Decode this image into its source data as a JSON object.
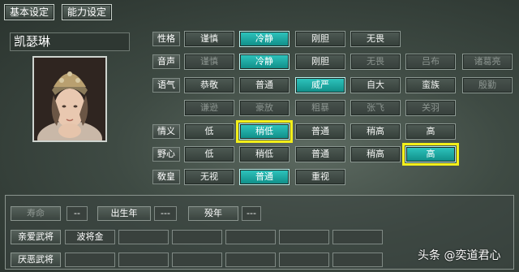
{
  "tabs": [
    "基本设定",
    "能力设定"
  ],
  "general_name": "凯瑟琳",
  "rows": [
    {
      "label": "性格",
      "options": [
        {
          "text": "谨慎",
          "state": "normal"
        },
        {
          "text": "冷静",
          "state": "selected"
        },
        {
          "text": "刚胆",
          "state": "normal"
        },
        {
          "text": "无畏",
          "state": "normal"
        }
      ]
    },
    {
      "label": "音声",
      "options": [
        {
          "text": "谨慎",
          "state": "disabled"
        },
        {
          "text": "冷静",
          "state": "selected"
        },
        {
          "text": "刚胆",
          "state": "normal"
        },
        {
          "text": "无畏",
          "state": "disabled"
        },
        {
          "text": "吕布",
          "state": "disabled"
        },
        {
          "text": "诸葛亮",
          "state": "disabled"
        }
      ]
    },
    {
      "label": "语气",
      "options": [
        {
          "text": "恭敬",
          "state": "normal"
        },
        {
          "text": "普通",
          "state": "normal"
        },
        {
          "text": "威严",
          "state": "selected"
        },
        {
          "text": "自大",
          "state": "normal"
        },
        {
          "text": "蛮族",
          "state": "normal"
        },
        {
          "text": "殷勤",
          "state": "disabled"
        }
      ]
    },
    {
      "label": "",
      "options": [
        {
          "text": "谦逊",
          "state": "disabled"
        },
        {
          "text": "豪放",
          "state": "disabled"
        },
        {
          "text": "粗暴",
          "state": "disabled"
        },
        {
          "text": "张飞",
          "state": "disabled"
        },
        {
          "text": "关羽",
          "state": "disabled"
        }
      ]
    },
    {
      "label": "情义",
      "options": [
        {
          "text": "低",
          "state": "normal"
        },
        {
          "text": "稍低",
          "state": "selected-highlight"
        },
        {
          "text": "普通",
          "state": "normal"
        },
        {
          "text": "稍高",
          "state": "normal"
        },
        {
          "text": "高",
          "state": "normal"
        }
      ]
    },
    {
      "label": "野心",
      "options": [
        {
          "text": "低",
          "state": "normal"
        },
        {
          "text": "稍低",
          "state": "normal"
        },
        {
          "text": "普通",
          "state": "normal"
        },
        {
          "text": "稍高",
          "state": "normal"
        },
        {
          "text": "高",
          "state": "selected-highlight"
        }
      ]
    },
    {
      "label": "敎皇",
      "options": [
        {
          "text": "无视",
          "state": "normal"
        },
        {
          "text": "普通",
          "state": "selected"
        },
        {
          "text": "重视",
          "state": "normal"
        }
      ]
    }
  ],
  "bottom": {
    "lifespan_label": "寿命",
    "lifespan_value": "--",
    "birth_label": "出生年",
    "birth_value": "---",
    "death_label": "殁年",
    "death_value": "---",
    "favorite_label": "亲爱武将",
    "favorite_values": [
      "波将金",
      "",
      "",
      "",
      "",
      ""
    ],
    "disliked_label": "厌恶武将",
    "disliked_values": [
      "",
      "",
      "",
      "",
      "",
      ""
    ]
  },
  "watermark": "头条 @奕道君心"
}
